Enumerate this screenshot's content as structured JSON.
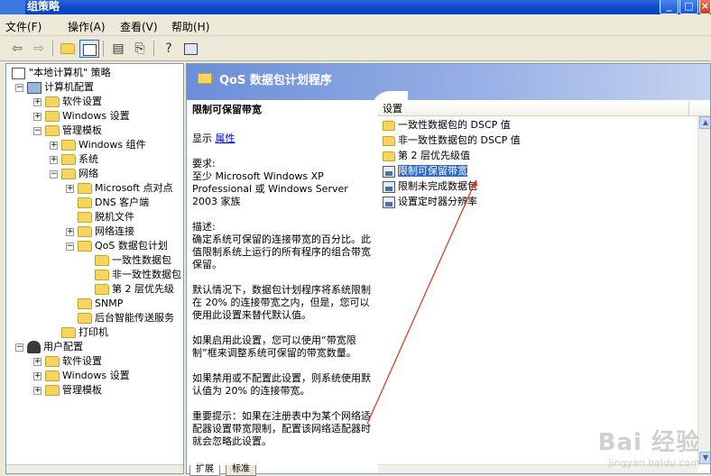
{
  "window": {
    "title": "组策略"
  },
  "menubar": [
    "文件(F)",
    "操作(A)",
    "查看(V)",
    "帮助(H)"
  ],
  "tree": {
    "root": "\"本地计算机\" 策略",
    "computer": "计算机配置",
    "software": "软件设置",
    "windows_settings": "Windows 设置",
    "admin_templates": "管理模板",
    "windows_components": "Windows 组件",
    "system": "系统",
    "network": "网络",
    "ms_net_client": "Microsoft 点对点",
    "dns_client": "DNS 客户端",
    "offline_files": "脱机文件",
    "network_connections": "网络连接",
    "qos": "QoS 数据包计划",
    "dscp_conforming": "一致性数据包",
    "dscp_nonconforming": "非一致性数据包",
    "layer2": "第 2 层优先级",
    "snmp": "SNMP",
    "bits": "后台智能传送服务",
    "printers": "打印机",
    "user": "用户配置",
    "user_software": "软件设置",
    "user_windows_settings": "Windows 设置",
    "user_admin_templates": "管理模板"
  },
  "header": {
    "title": "QoS 数据包计划程序"
  },
  "description": {
    "policy_title": "限制可保留带宽",
    "show_label": "显示",
    "properties_link": "属性",
    "requirements_label": "要求:",
    "requirements_text": "至少 Microsoft Windows XP Professional 或 Windows Server 2003 家族",
    "desc_label": "描述:",
    "desc_text": "确定系统可保留的连接带宽的百分比。此值限制系统上运行的所有程序的组合带宽保留。",
    "default_text": "默认情况下，数据包计划程序将系统限制在 20% 的连接带宽之内，但是，您可以使用此设置来替代默认值。",
    "enabled_text": "如果启用此设置，您可以使用“带宽限制”框来调整系统可保留的带宽数量。",
    "disabled_text": "如果禁用或不配置此设置，则系统使用默认值为 20% 的连接带宽。",
    "important_text": "重要提示：如果在注册表中为某个网络适配器设置带宽限制，配置该网络适配器时就会忽略此设置。"
  },
  "list": {
    "header": "设置",
    "items": [
      "一致性数据包的 DSCP 值",
      "非一致性数据包的 DSCP 值",
      "第 2 层优先级值",
      "限制可保留带宽",
      "限制未完成数据包",
      "设置定时器分辨率"
    ],
    "selected_index": 3
  },
  "tabs": [
    "扩展",
    "标准"
  ],
  "watermark": {
    "brand": "Bai 经验",
    "url": "jingyan.baidu.com"
  },
  "colors": {
    "selection": "#316ac5",
    "header_gradient_start": "#6b8ed8",
    "annotation_arrow": "#e03020"
  }
}
